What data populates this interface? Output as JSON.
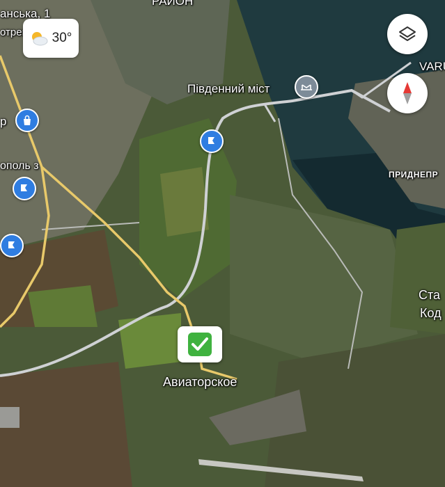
{
  "weather": {
    "temperature": "30°",
    "icon": "partly-cloudy-icon"
  },
  "labels": {
    "top_left": "анська, 1",
    "top_left2": "отрец",
    "top_center": "РАЙОН",
    "bridge": "Південний міст",
    "left_r": "р",
    "left_topol": "ополь з",
    "varu": "VARU",
    "prydnipr": "ПРИДНЕПР",
    "stan": "Ста",
    "kod": "Код",
    "aviatorskoe": "Авиаторское"
  },
  "controls": {
    "layers": "layers-icon",
    "compass": "compass-icon"
  },
  "colors": {
    "road": "#e8c96a",
    "water": "#1f3a3f",
    "pin": "#2f7de1",
    "check": "#3fb23f"
  }
}
